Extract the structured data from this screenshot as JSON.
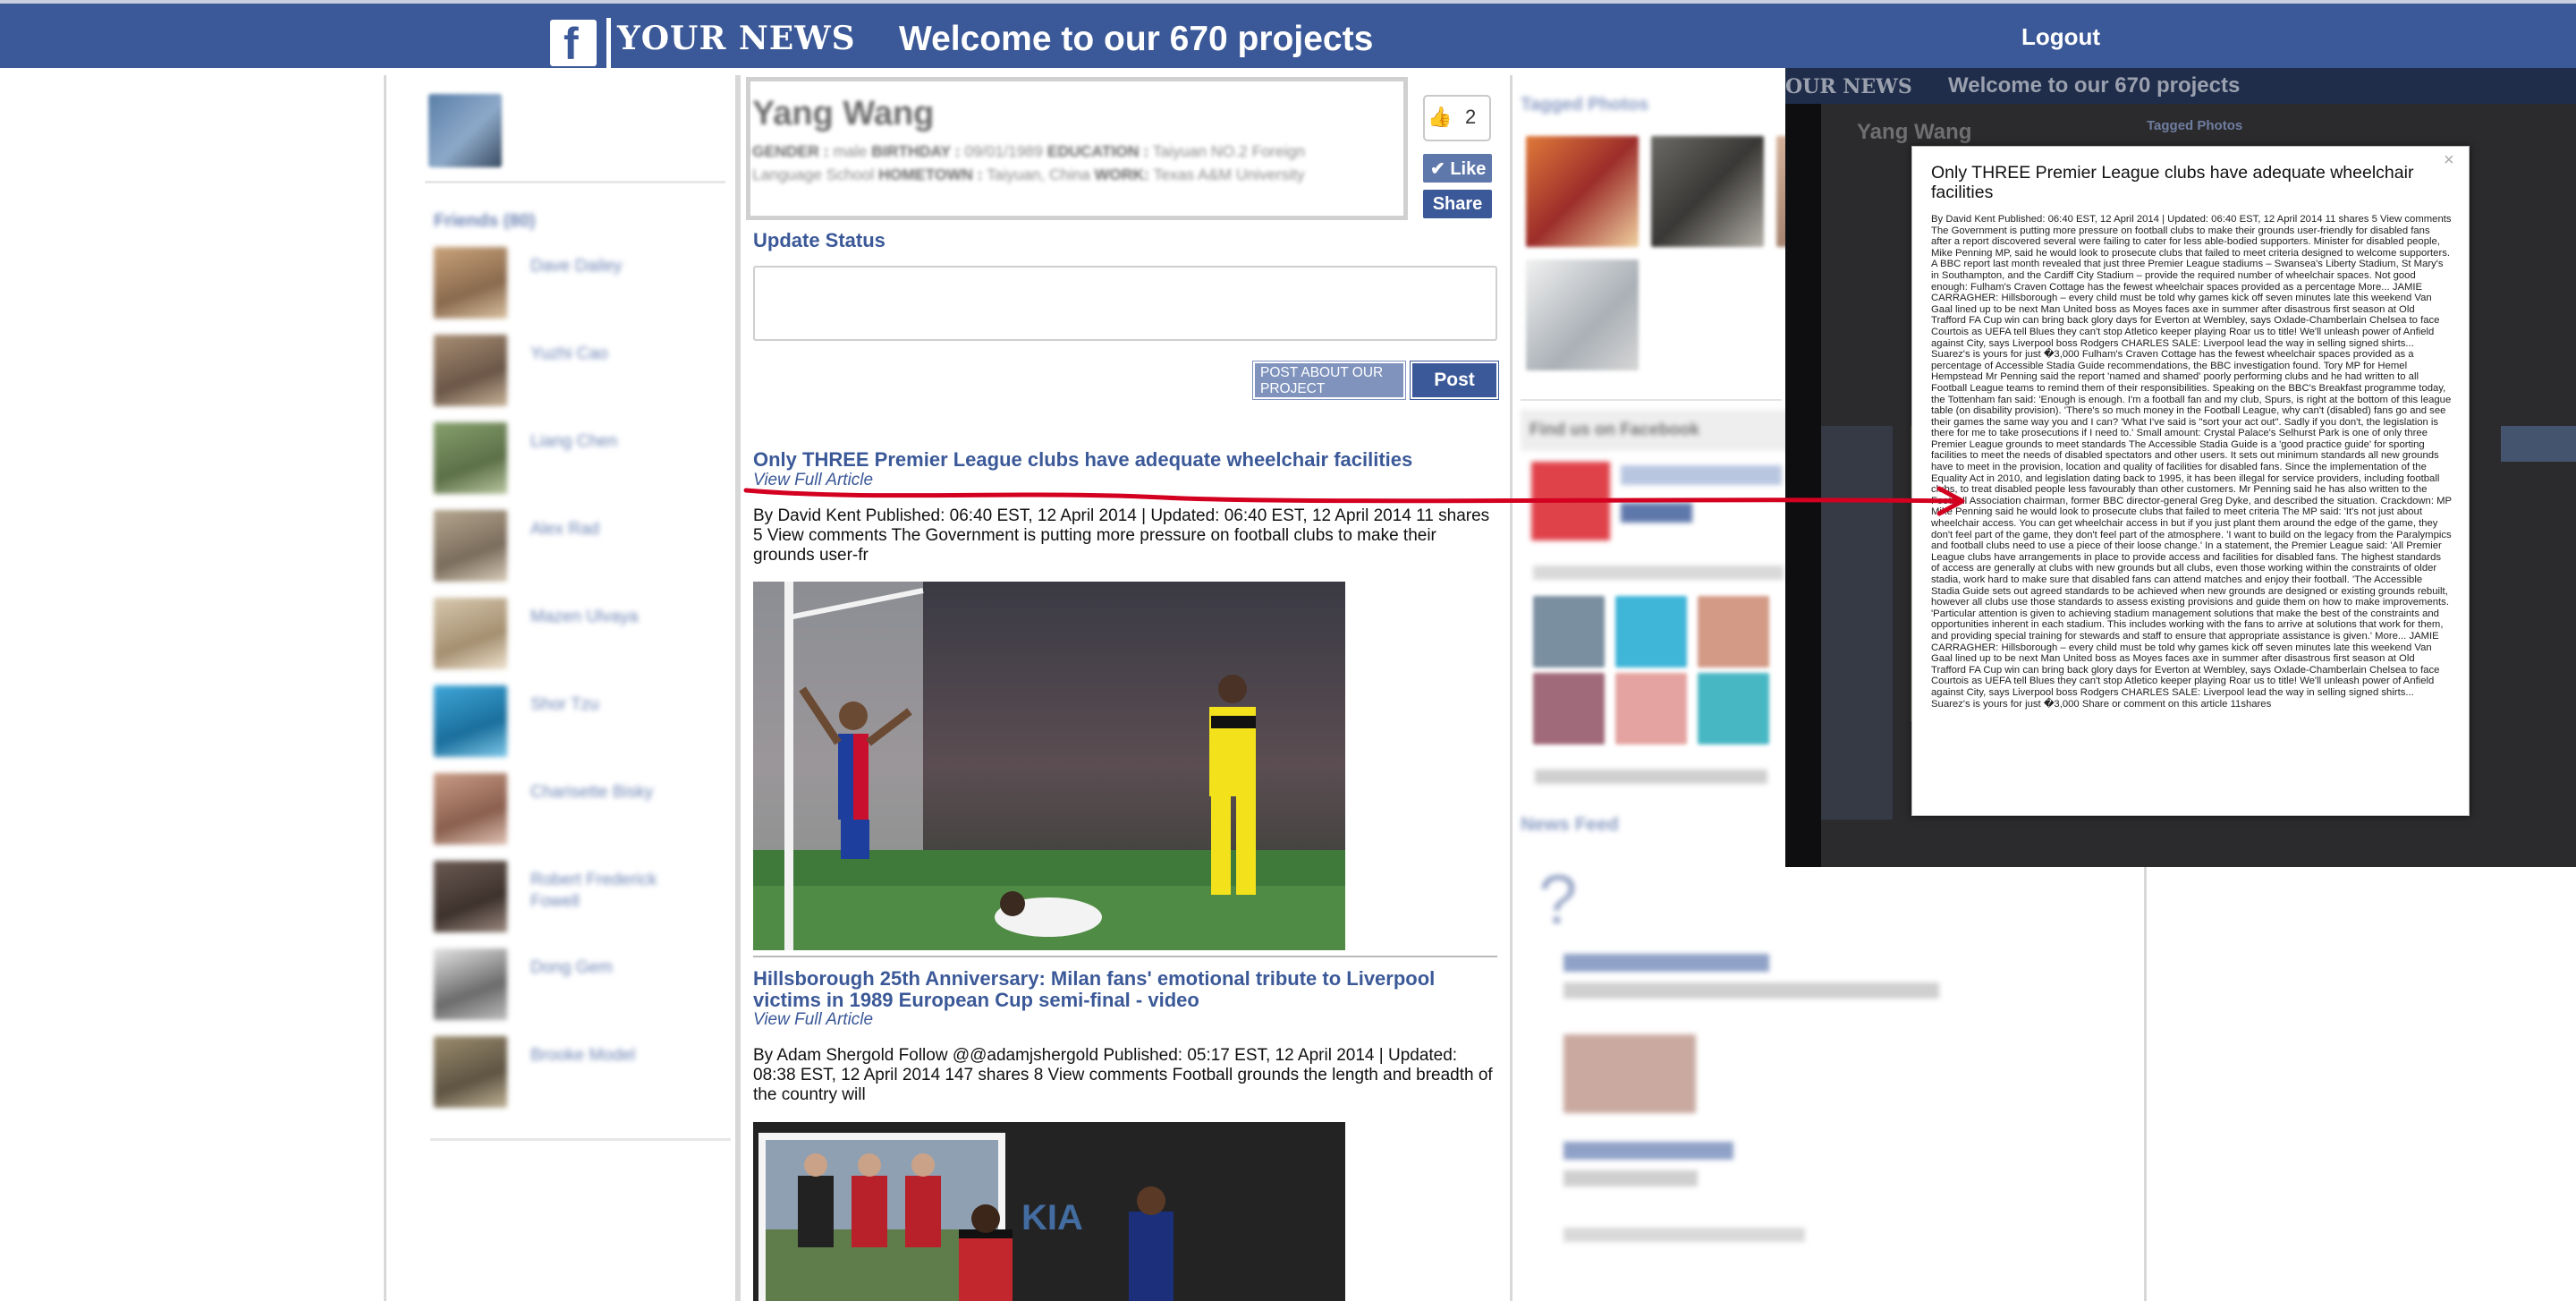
{
  "header": {
    "brand": "YOUR NEWS",
    "welcome": "Welcome to our 670 projects",
    "logout": "Logout",
    "colors": {
      "bar": "#3b5998",
      "accent": "#d40020"
    }
  },
  "sidebar": {
    "friends_title": "Friends (80)",
    "friends": [
      {
        "name": "Dave Dailey",
        "icon": "friend-avatar"
      },
      {
        "name": "Yuzhi Cao",
        "icon": "friend-avatar"
      },
      {
        "name": "Liang Chen",
        "icon": "friend-avatar"
      },
      {
        "name": "Alex Rad",
        "icon": "friend-avatar"
      },
      {
        "name": "Mazen Ulvaya",
        "icon": "friend-avatar"
      },
      {
        "name": "Shor Tzu",
        "icon": "friend-avatar"
      },
      {
        "name": "Charisette Bisky",
        "icon": "friend-avatar"
      },
      {
        "name": "Robert Frederick Fowell",
        "icon": "friend-avatar"
      },
      {
        "name": "Dong Gem",
        "icon": "friend-avatar"
      },
      {
        "name": "Brooke Model",
        "icon": "friend-avatar"
      }
    ]
  },
  "profile": {
    "name": "Yang Wang",
    "gender_label": "GENDER :",
    "gender": "male",
    "birthday_label": "BIRTHDAY :",
    "birthday": "09/01/1989",
    "education_label": "EDUCATION :",
    "education": "Taiyuan NO.2 Foreign Language School",
    "hometown_label": "HOMETOWN :",
    "hometown": "Taiyuan, China",
    "work_label": "WORK:",
    "work": "Texas A&M University",
    "like_count": "2",
    "like_label": "Like",
    "share_label": "Share"
  },
  "status": {
    "label": "Update Status",
    "placeholder": "",
    "post_about_label": "POST ABOUT OUR PROJECT",
    "post_label": "Post"
  },
  "articles": [
    {
      "title": "Only THREE Premier League clubs have adequate wheelchair facilities",
      "view_full": "View Full Article",
      "snippet": "By David Kent Published: 06:40 EST, 12 April 2014 | Updated: 06:40 EST, 12 April 2014 11 shares 5 View comments The Government is putting more pressure on football clubs to make their grounds user-fr"
    },
    {
      "title": "Hillsborough 25th Anniversary: Milan fans' emotional tribute to Liverpool victims in 1989 European Cup semi-final - video",
      "view_full": "View Full Article",
      "snippet": "By Adam Shergold Follow @@adamjshergold Published: 05:17 EST, 12 April 2014 | Updated: 08:38 EST, 12 April 2014 147 shares 8 View comments Football grounds the length and breadth of the country will"
    }
  ],
  "right_column": {
    "tagged_title": "Tagged Photos",
    "find_us": "Find us on Facebook",
    "news_feed": "News Feed"
  },
  "overlay": {
    "brand": "OUR NEWS",
    "welcome": "Welcome to our 670 projects",
    "name": "Yang Wang",
    "tagged": "Tagged Photos"
  },
  "modal": {
    "close": "×",
    "title": "Only THREE Premier League clubs have adequate wheelchair facilities",
    "body": "By David Kent Published: 06:40 EST, 12 April 2014 | Updated: 06:40 EST, 12 April 2014 11 shares 5 View comments The Government is putting more pressure on football clubs to make their grounds user-friendly for disabled fans after a report discovered several were failing to cater for less able-bodied supporters. Minister for disabled people, Mike Penning MP, said he would look to prosecute clubs that failed to meet criteria designed to welcome supporters. A BBC report last month revealed that just three Premier League stadiums – Swansea's Liberty Stadium, St Mary's in Southampton, and the Cardiff City Stadium – provide the required number of wheelchair spaces. Not good enough: Fulham's Craven Cottage has the fewest wheelchair spaces provided as a percentage More... JAMIE CARRAGHER: Hillsborough – every child must be told why games kick off seven minutes late this weekend Van Gaal lined up to be next Man United boss as Moyes faces axe in summer after disastrous first season at Old Trafford FA Cup win can bring back glory days for Everton at Wembley, says Oxlade-Chamberlain Chelsea to face Courtois as UEFA tell Blues they can't stop Atletico keeper playing Roar us to title! We'll unleash power of Anfield against City, says Liverpool boss Rodgers CHARLES SALE: Liverpool lead the way in selling signed shirts... Suarez's is yours for just �3,000 Fulham's Craven Cottage has the fewest wheelchair spaces provided as a percentage of Accessible Stadia Guide recommendations, the BBC investigation found. Tory MP for Hemel Hempstead Mr Penning said the report 'named and shamed' poorly performing clubs and he had written to all Football League teams to remind them of their responsibilities. Speaking on the BBC's Breakfast programme today, the Tottenham fan said: 'Enough is enough. I'm a football fan and my club, Spurs, is right at the bottom of this league table (on disability provision). 'There's so much money in the Football League, why can't (disabled) fans go and see their games the same way you and I can? 'What I've said is \"sort your act out\". Sadly if you don't, the legislation is there for me to take prosecutions if I need to.' Small amount: Crystal Palace's Selhurst Park is one of only three Premier League grounds to meet standards The Accessible Stadia Guide is a 'good practice guide' for sporting facilities to meet the needs of disabled spectators and other users. It sets out minimum standards all new grounds have to meet in the provision, location and quality of facilities for disabled fans. Since the implementation of the Equality Act in 2010, and legislation dating back to 1995, it has been illegal for service providers, including football clubs, to treat disabled people less favourably than other customers. Mr Penning said he has also written to the Football Association chairman, former BBC director-general Greg Dyke, and described the situation. Crackdown: MP Mike Penning said he would look to prosecute clubs that failed to meet criteria The MP said: 'It's not just about wheelchair access. You can get wheelchair access in but if you just plant them around the edge of the game, they don't feel part of the game, they don't feel part of the atmosphere. 'I want to build on the legacy from the Paralympics and football clubs need to use a piece of their loose change.' In a statement, the Premier League said: 'All Premier League clubs have arrangements in place to provide access and facilities for disabled fans. The highest standards of access are generally at clubs with new grounds but all clubs, even those working within the constraints of older stadia, work hard to make sure that disabled fans can attend matches and enjoy their football. 'The Accessible Stadia Guide sets out agreed standards to be achieved when new grounds are designed or existing grounds rebuilt, however all clubs use those standards to assess existing provisions and guide them on how to make improvements. 'Particular attention is given to achieving stadium management solutions that make the best of the constraints and opportunities inherent in each stadium. This includes working with the fans to arrive at solutions that work for them, and providing special training for stewards and staff to ensure that appropriate assistance is given.' More... JAMIE CARRAGHER: Hillsborough – every child must be told why games kick off seven minutes late this weekend Van Gaal lined up to be next Man United boss as Moyes faces axe in summer after disastrous first season at Old Trafford FA Cup win can bring back glory days for Everton at Wembley, says Oxlade-Chamberlain Chelsea to face Courtois as UEFA tell Blues they can't stop Atletico keeper playing Roar us to title! We'll unleash power of Anfield against City, says Liverpool boss Rodgers CHARLES SALE: Liverpool lead the way in selling signed shirts... Suarez's is yours for just �3,000 Share or comment on this article 11shares"
  }
}
